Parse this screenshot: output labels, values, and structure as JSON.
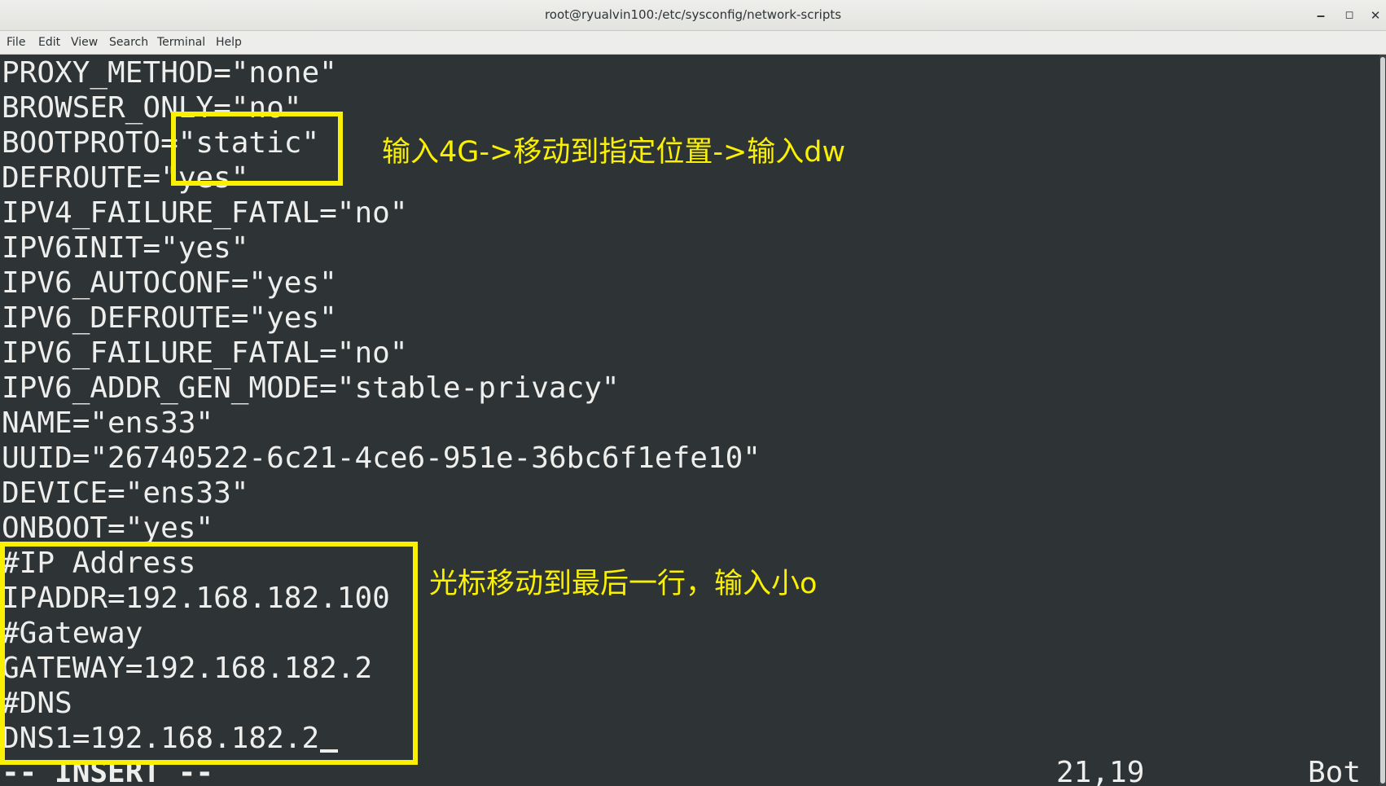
{
  "window": {
    "title": "root@ryualvin100:/etc/sysconfig/network-scripts",
    "minimize_glyph": "‒",
    "maximize_glyph": "◻",
    "close_glyph": "✕"
  },
  "menu": {
    "file": "File",
    "edit": "Edit",
    "view": "View",
    "search": "Search",
    "terminal": "Terminal",
    "help": "Help"
  },
  "lines": [
    "PROXY_METHOD=\"none\"",
    "BROWSER_ONLY=\"no\"",
    "BOOTPROTO=\"static\"",
    "DEFROUTE=\"yes\"",
    "IPV4_FAILURE_FATAL=\"no\"",
    "IPV6INIT=\"yes\"",
    "IPV6_AUTOCONF=\"yes\"",
    "IPV6_DEFROUTE=\"yes\"",
    "IPV6_FAILURE_FATAL=\"no\"",
    "IPV6_ADDR_GEN_MODE=\"stable-privacy\"",
    "NAME=\"ens33\"",
    "UUID=\"26740522-6c21-4ce6-951e-36bc6f1efe10\"",
    "DEVICE=\"ens33\"",
    "ONBOOT=\"yes\"",
    "#IP Address",
    "IPADDR=192.168.182.100",
    "#Gateway",
    "GATEWAY=192.168.182.2",
    "#DNS",
    "DNS1=192.168.182.2"
  ],
  "status": {
    "mode": "-- INSERT --",
    "position": "21,19",
    "scroll": "Bot"
  },
  "annotations": {
    "note1": "输入4G->移动到指定位置->输入dw",
    "note2": "光标移动到最后一行，输入小o",
    "color": "#f9f004"
  },
  "colors": {
    "terminal_bg": "#2e3436",
    "terminal_fg": "#eeeeec",
    "titlebar_bg": "#e8e8e7"
  }
}
